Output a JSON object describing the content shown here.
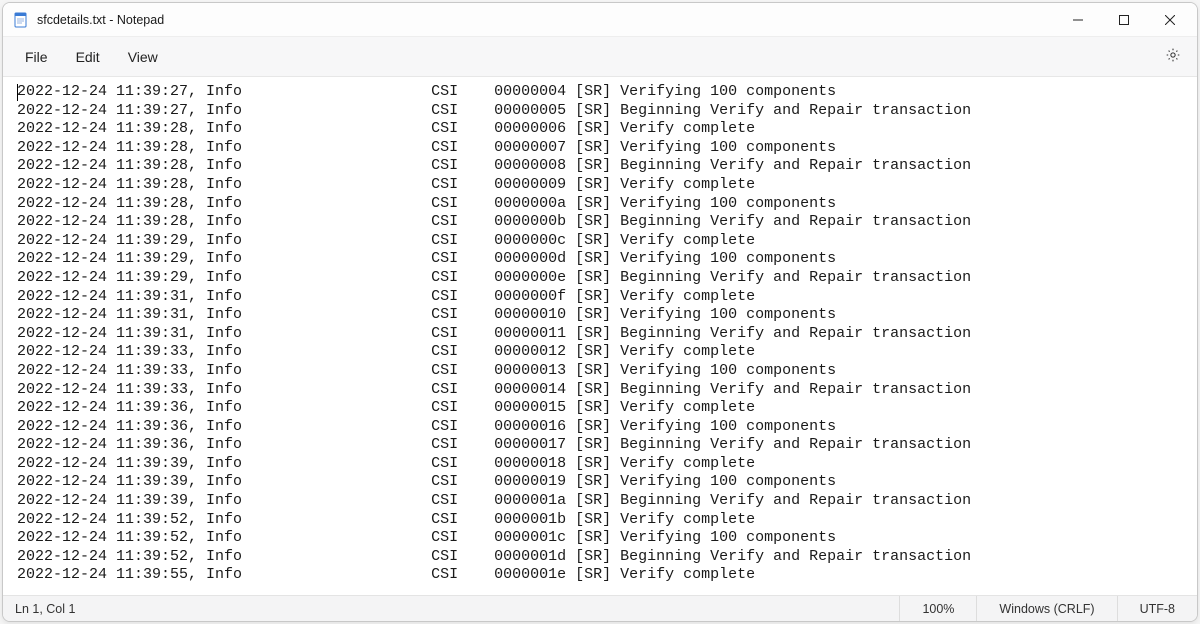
{
  "window": {
    "title": "sfcdetails.txt - Notepad"
  },
  "menu": {
    "file": "File",
    "edit": "Edit",
    "view": "View"
  },
  "status": {
    "position": "Ln 1, Col 1",
    "zoom": "100%",
    "line_ending": "Windows (CRLF)",
    "encoding": "UTF-8"
  },
  "log": {
    "col_source": "CSI",
    "col_tag": "[SR]",
    "level": "Info",
    "lines": [
      {
        "ts": "2022-12-24 11:39:27",
        "seq": "00000004",
        "msg": "Verifying 100 components"
      },
      {
        "ts": "2022-12-24 11:39:27",
        "seq": "00000005",
        "msg": "Beginning Verify and Repair transaction"
      },
      {
        "ts": "2022-12-24 11:39:28",
        "seq": "00000006",
        "msg": "Verify complete"
      },
      {
        "ts": "2022-12-24 11:39:28",
        "seq": "00000007",
        "msg": "Verifying 100 components"
      },
      {
        "ts": "2022-12-24 11:39:28",
        "seq": "00000008",
        "msg": "Beginning Verify and Repair transaction"
      },
      {
        "ts": "2022-12-24 11:39:28",
        "seq": "00000009",
        "msg": "Verify complete"
      },
      {
        "ts": "2022-12-24 11:39:28",
        "seq": "0000000a",
        "msg": "Verifying 100 components"
      },
      {
        "ts": "2022-12-24 11:39:28",
        "seq": "0000000b",
        "msg": "Beginning Verify and Repair transaction"
      },
      {
        "ts": "2022-12-24 11:39:29",
        "seq": "0000000c",
        "msg": "Verify complete"
      },
      {
        "ts": "2022-12-24 11:39:29",
        "seq": "0000000d",
        "msg": "Verifying 100 components"
      },
      {
        "ts": "2022-12-24 11:39:29",
        "seq": "0000000e",
        "msg": "Beginning Verify and Repair transaction"
      },
      {
        "ts": "2022-12-24 11:39:31",
        "seq": "0000000f",
        "msg": "Verify complete"
      },
      {
        "ts": "2022-12-24 11:39:31",
        "seq": "00000010",
        "msg": "Verifying 100 components"
      },
      {
        "ts": "2022-12-24 11:39:31",
        "seq": "00000011",
        "msg": "Beginning Verify and Repair transaction"
      },
      {
        "ts": "2022-12-24 11:39:33",
        "seq": "00000012",
        "msg": "Verify complete"
      },
      {
        "ts": "2022-12-24 11:39:33",
        "seq": "00000013",
        "msg": "Verifying 100 components"
      },
      {
        "ts": "2022-12-24 11:39:33",
        "seq": "00000014",
        "msg": "Beginning Verify and Repair transaction"
      },
      {
        "ts": "2022-12-24 11:39:36",
        "seq": "00000015",
        "msg": "Verify complete"
      },
      {
        "ts": "2022-12-24 11:39:36",
        "seq": "00000016",
        "msg": "Verifying 100 components"
      },
      {
        "ts": "2022-12-24 11:39:36",
        "seq": "00000017",
        "msg": "Beginning Verify and Repair transaction"
      },
      {
        "ts": "2022-12-24 11:39:39",
        "seq": "00000018",
        "msg": "Verify complete"
      },
      {
        "ts": "2022-12-24 11:39:39",
        "seq": "00000019",
        "msg": "Verifying 100 components"
      },
      {
        "ts": "2022-12-24 11:39:39",
        "seq": "0000001a",
        "msg": "Beginning Verify and Repair transaction"
      },
      {
        "ts": "2022-12-24 11:39:52",
        "seq": "0000001b",
        "msg": "Verify complete"
      },
      {
        "ts": "2022-12-24 11:39:52",
        "seq": "0000001c",
        "msg": "Verifying 100 components"
      },
      {
        "ts": "2022-12-24 11:39:52",
        "seq": "0000001d",
        "msg": "Beginning Verify and Repair transaction"
      },
      {
        "ts": "2022-12-24 11:39:55",
        "seq": "0000001e",
        "msg": "Verify complete"
      }
    ]
  }
}
